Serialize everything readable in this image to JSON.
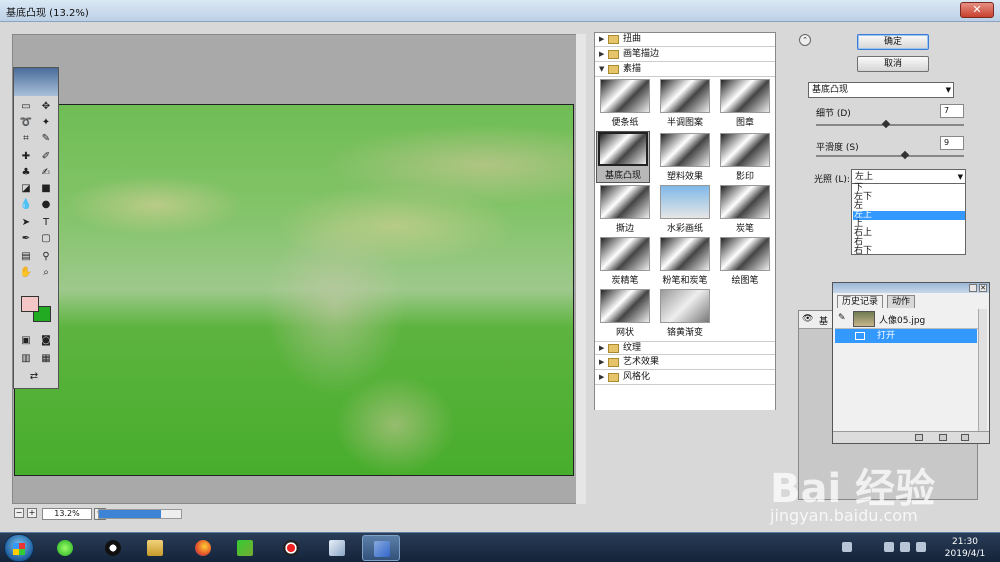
{
  "window": {
    "title": "基底凸现 (13.2%)",
    "close_label": "✕"
  },
  "preview": {
    "zoom": "13.2%",
    "zoom_minus": "−",
    "zoom_plus": "+",
    "progress": 0.75
  },
  "filter_list": {
    "categories_top": [
      {
        "label": "扭曲",
        "expanded": false
      },
      {
        "label": "画笔描边",
        "expanded": false
      },
      {
        "label": "素描",
        "expanded": true
      }
    ],
    "thumbnails": [
      {
        "label": "便条纸",
        "selected": false
      },
      {
        "label": "半调图案",
        "selected": false
      },
      {
        "label": "图章",
        "selected": false
      },
      {
        "label": "基底凸现",
        "selected": true
      },
      {
        "label": "塑料效果",
        "selected": false
      },
      {
        "label": "影印",
        "selected": false
      },
      {
        "label": "撕边",
        "selected": false
      },
      {
        "label": "水彩画纸",
        "selected": false
      },
      {
        "label": "炭笔",
        "selected": false
      },
      {
        "label": "炭精笔",
        "selected": false
      },
      {
        "label": "粉笔和炭笔",
        "selected": false
      },
      {
        "label": "绘图笔",
        "selected": false
      },
      {
        "label": "网状",
        "selected": false
      },
      {
        "label": "铬黄渐变",
        "selected": false
      }
    ],
    "categories_bottom": [
      {
        "label": "纹理",
        "expanded": false
      },
      {
        "label": "艺术效果",
        "expanded": false
      },
      {
        "label": "风格化",
        "expanded": false
      }
    ]
  },
  "buttons": {
    "ok": "确定",
    "cancel": "取消"
  },
  "settings": {
    "filter_select": "基底凸现",
    "detail_label": "细节 (D)",
    "detail_value": "7",
    "detail_level": 0.47,
    "smooth_label": "平滑度 (S)",
    "smooth_value": "9",
    "smooth_level": 0.6,
    "light_label": "光照 (L):",
    "light_value": "左上",
    "light_options": [
      "下",
      "左下",
      "左",
      "左上",
      "上",
      "右上",
      "右",
      "右下"
    ],
    "light_selected_index": 3
  },
  "layers": {
    "row_label": "基"
  },
  "history": {
    "tab_history": "历史记录",
    "tab_actions": "动作",
    "snapshot_name": "人像05.jpg",
    "step_name": "打开"
  },
  "taskbar": {
    "time": "21:30",
    "date": "2019/4/1"
  },
  "watermark": {
    "logo": "Bai  经验",
    "url": "jingyan.baidu.com"
  },
  "colors": {
    "foreground": "#f4c6c6",
    "background": "#22aa22",
    "selection": "#3399ff"
  }
}
